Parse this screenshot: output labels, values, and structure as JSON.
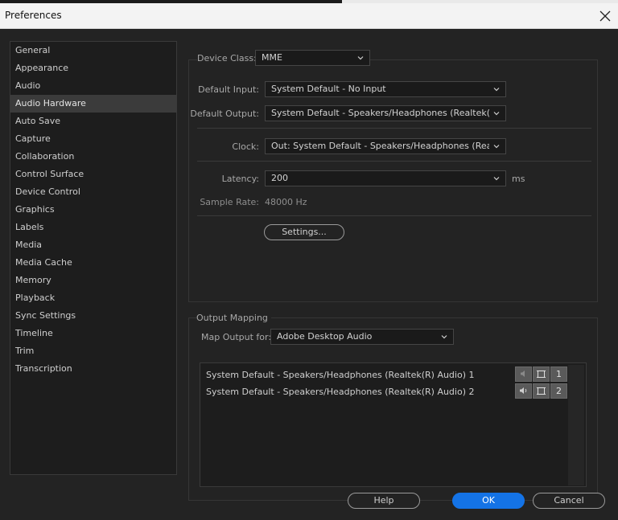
{
  "window": {
    "title": "Preferences"
  },
  "sidebar": {
    "items": [
      {
        "label": "General"
      },
      {
        "label": "Appearance"
      },
      {
        "label": "Audio"
      },
      {
        "label": "Audio Hardware",
        "selected": true
      },
      {
        "label": "Auto Save"
      },
      {
        "label": "Capture"
      },
      {
        "label": "Collaboration"
      },
      {
        "label": "Control Surface"
      },
      {
        "label": "Device Control"
      },
      {
        "label": "Graphics"
      },
      {
        "label": "Labels"
      },
      {
        "label": "Media"
      },
      {
        "label": "Media Cache"
      },
      {
        "label": "Memory"
      },
      {
        "label": "Playback"
      },
      {
        "label": "Sync Settings"
      },
      {
        "label": "Timeline"
      },
      {
        "label": "Trim"
      },
      {
        "label": "Transcription"
      }
    ]
  },
  "device": {
    "class_label": "Device Class:",
    "class_value": "MME",
    "input_label": "Default Input:",
    "input_value": "System Default - No Input",
    "output_label": "Default Output:",
    "output_value": "System Default - Speakers/Headphones (Realtek(R) ...",
    "clock_label": "Clock:",
    "clock_value": "Out: System Default - Speakers/Headphones (Realtek...",
    "latency_label": "Latency:",
    "latency_value": "200",
    "latency_unit": "ms",
    "sample_rate_label": "Sample Rate:",
    "sample_rate_value": "48000 Hz",
    "settings_button": "Settings..."
  },
  "output_mapping": {
    "group_label": "Output Mapping",
    "map_for_label": "Map Output for:",
    "map_for_value": "Adobe Desktop Audio",
    "rows": [
      {
        "label": "System Default - Speakers/Headphones (Realtek(R) Audio) 1",
        "channel": "1"
      },
      {
        "label": "System Default - Speakers/Headphones (Realtek(R) Audio) 2",
        "channel": "2"
      }
    ]
  },
  "footer": {
    "help": "Help",
    "ok": "OK",
    "cancel": "Cancel"
  },
  "icons": {
    "close": "close-icon",
    "chevron": "chevron-down-icon",
    "speaker": "speaker-icon",
    "frame": "frame-icon"
  },
  "colors": {
    "accent": "#1473e6",
    "background": "#232323"
  }
}
